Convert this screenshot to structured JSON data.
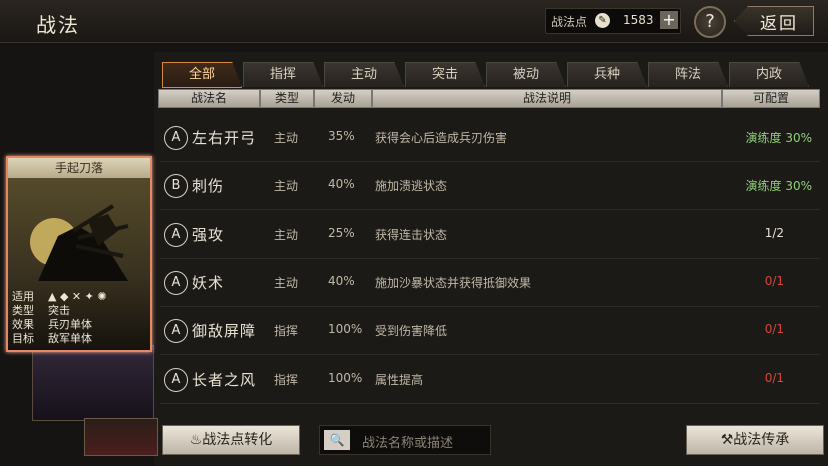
{
  "header": {
    "title": "战法",
    "points_label": "战法点",
    "points_value": "1583",
    "help_label": "?",
    "back_label": "返回"
  },
  "tabs": [
    {
      "label": "全部",
      "active": true
    },
    {
      "label": "指挥"
    },
    {
      "label": "主动"
    },
    {
      "label": "突击"
    },
    {
      "label": "被动"
    },
    {
      "label": "兵种"
    },
    {
      "label": "阵法"
    },
    {
      "label": "内政"
    }
  ],
  "columns": [
    "战法名",
    "类型",
    "发动",
    "战法说明",
    "可配置"
  ],
  "rows": [
    {
      "grade": "A",
      "name": "左右开弓",
      "type": "主动",
      "rate": "35%",
      "desc": "获得会心后造成兵刃伤害",
      "config": "演练度 30%",
      "config_color": "green"
    },
    {
      "grade": "B",
      "name": "刺伤",
      "type": "主动",
      "rate": "40%",
      "desc": "施加溃逃状态",
      "config": "演练度 30%",
      "config_color": "green"
    },
    {
      "grade": "A",
      "name": "强攻",
      "type": "主动",
      "rate": "25%",
      "desc": "获得连击状态",
      "config": "1/2",
      "config_color": "white"
    },
    {
      "grade": "A",
      "name": "妖术",
      "type": "主动",
      "rate": "40%",
      "desc": "施加沙暴状态并获得抵御效果",
      "config": "0/1",
      "config_color": "red"
    },
    {
      "grade": "A",
      "name": "御敌屏障",
      "type": "指挥",
      "rate": "100%",
      "desc": "受到伤害降低",
      "config": "0/1",
      "config_color": "red"
    },
    {
      "grade": "A",
      "name": "长者之风",
      "type": "指挥",
      "rate": "100%",
      "desc": "属性提高",
      "config": "0/1",
      "config_color": "red"
    }
  ],
  "card": {
    "title": "手起刀落",
    "fields": [
      {
        "key": "适用",
        "value": ""
      },
      {
        "key": "类型",
        "value": "突击"
      },
      {
        "key": "效果",
        "value": "兵刃单体"
      },
      {
        "key": "目标",
        "value": "敌军单体"
      }
    ]
  },
  "bottom": {
    "convert_label": "战法点转化",
    "search_placeholder": "战法名称或描述",
    "inherit_label": "战法传承"
  },
  "colors": {
    "accent": "#d48a3a",
    "green": "#8fcf7a",
    "red": "#d6463a"
  }
}
